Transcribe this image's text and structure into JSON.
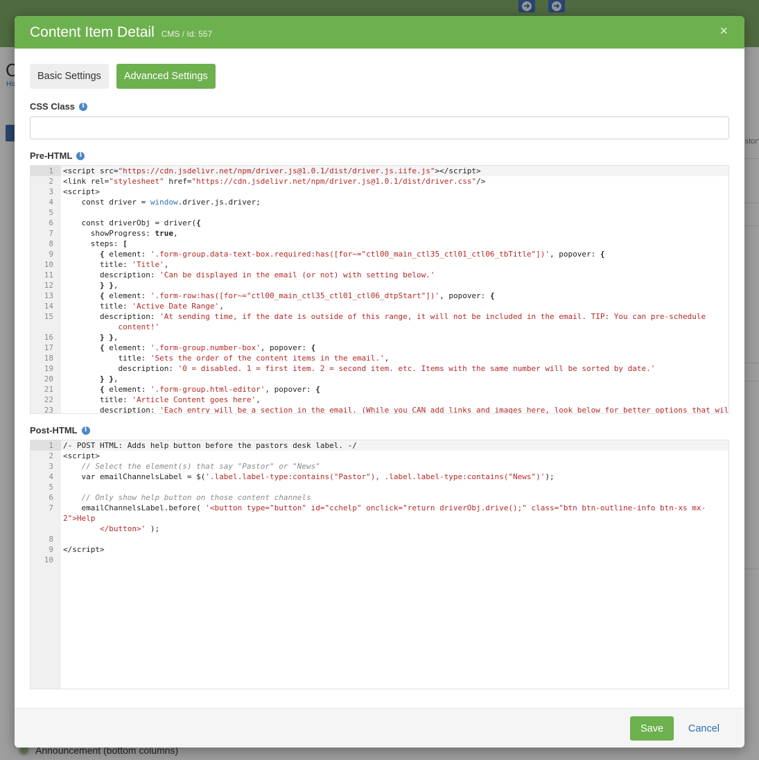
{
  "background": {
    "heading": "C",
    "breadcrumb": "Ho",
    "right_text": "stor'",
    "announcement": "Announcement (bottom columns)"
  },
  "modal": {
    "title": "Content Item Detail",
    "subtitle": "CMS / Id: 557",
    "close_label": "×",
    "tabs": [
      {
        "label": "Basic Settings",
        "active": false
      },
      {
        "label": "Advanced Settings",
        "active": true
      }
    ],
    "css_class": {
      "label": "CSS Class",
      "value": ""
    },
    "pre_html": {
      "label": "Pre-HTML"
    },
    "post_html": {
      "label": "Post-HTML"
    },
    "footer": {
      "save_label": "Save",
      "cancel_label": "Cancel"
    }
  },
  "icons": {
    "info": "info-icon",
    "close": "close-icon",
    "nav": "arrow-circle-right-icon"
  },
  "colors": {
    "primary_green": "#6db04e",
    "link_blue": "#2a6ebb",
    "string_red": "#b42828",
    "info_blue": "#4f86c6"
  }
}
